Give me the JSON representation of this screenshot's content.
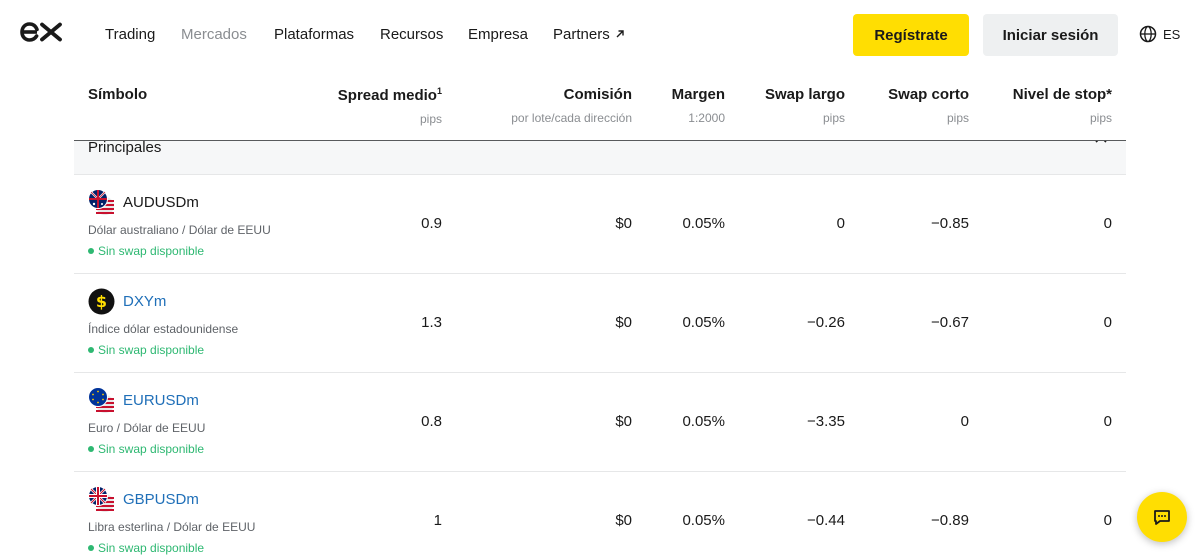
{
  "nav": {
    "links": [
      "Trading",
      "Mercados",
      "Plataformas",
      "Recursos",
      "Empresa",
      "Partners"
    ],
    "register": "Regístrate",
    "login": "Iniciar sesión",
    "lang": "ES"
  },
  "table": {
    "headers": [
      {
        "title": "Símbolo",
        "sub": ""
      },
      {
        "title": "Spread medio",
        "sup": "1",
        "sub": "pips"
      },
      {
        "title": "Comisión",
        "sub": "por lote/cada dirección"
      },
      {
        "title": "Margen",
        "sub": "1:2000"
      },
      {
        "title": "Swap largo",
        "sub": "pips"
      },
      {
        "title": "Swap corto",
        "sub": "pips"
      },
      {
        "title": "Nivel de stop*",
        "sub": "pips"
      }
    ],
    "group": "Principales",
    "rows": [
      {
        "symbol": "AUDUSDm",
        "desc": "Dólar australiano / Dólar de EEUU",
        "badge": "Sin swap disponible",
        "spread": "0.9",
        "commission": "$0",
        "margin": "0.05%",
        "swap_long": "0",
        "swap_short": "−0.85",
        "stop": "0"
      },
      {
        "symbol": "DXYm",
        "desc": "Índice dólar estadounidense",
        "badge": "Sin swap disponible",
        "spread": "1.3",
        "commission": "$0",
        "margin": "0.05%",
        "swap_long": "−0.26",
        "swap_short": "−0.67",
        "stop": "0"
      },
      {
        "symbol": "EURUSDm",
        "desc": "Euro / Dólar de EEUU",
        "badge": "Sin swap disponible",
        "spread": "0.8",
        "commission": "$0",
        "margin": "0.05%",
        "swap_long": "−3.35",
        "swap_short": "0",
        "stop": "0"
      },
      {
        "symbol": "GBPUSDm",
        "desc": "Libra esterlina / Dólar de EEUU",
        "badge": "Sin swap disponible",
        "spread": "1",
        "commission": "$0",
        "margin": "0.05%",
        "swap_long": "−0.44",
        "swap_short": "−0.89",
        "stop": "0"
      }
    ]
  },
  "colors": {
    "accent": "#ffde02",
    "link": "#1f6fb8",
    "swap_green": "#2eb872"
  }
}
